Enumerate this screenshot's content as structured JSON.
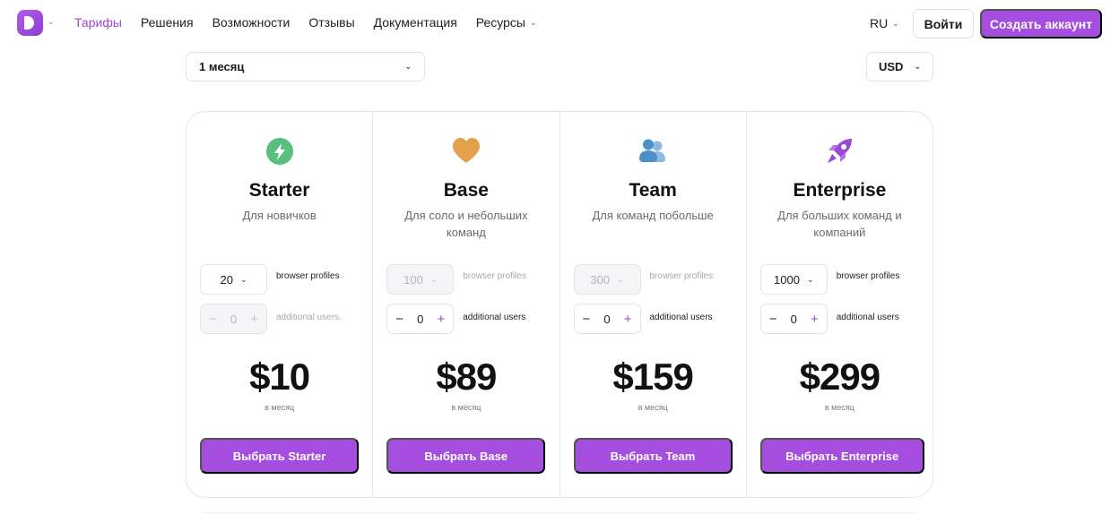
{
  "header": {
    "logo_icon": "logo-d-icon",
    "nav": [
      {
        "label": "Тарифы",
        "active": true,
        "has_dropdown": false
      },
      {
        "label": "Решения",
        "active": false,
        "has_dropdown": false
      },
      {
        "label": "Возможности",
        "active": false,
        "has_dropdown": false
      },
      {
        "label": "Отзывы",
        "active": false,
        "has_dropdown": false
      },
      {
        "label": "Документация",
        "active": false,
        "has_dropdown": false
      },
      {
        "label": "Ресурсы",
        "active": false,
        "has_dropdown": true
      }
    ],
    "language": "RU",
    "login_label": "Войти",
    "signup_label": "Создать аккаунт"
  },
  "selectors": {
    "period": "1 месяц",
    "currency": "USD"
  },
  "colors": {
    "accent": "#a44ddf",
    "starter_icon": "#57c07d",
    "base_icon": "#e3a04d",
    "team_icon": "#4a90c9",
    "enterprise_icon": "#9b47d8"
  },
  "plans": [
    {
      "icon": "lightning-icon",
      "name": "Starter",
      "description": "Для новичков",
      "profiles": "20",
      "profiles_label": "browser profiles",
      "profiles_disabled": false,
      "users": "0",
      "users_label": "additional users.",
      "users_disabled": true,
      "price": "$10",
      "per": "в месяц",
      "cta": "Выбрать Starter"
    },
    {
      "icon": "heart-icon",
      "name": "Base",
      "description": "Для соло и небольших команд",
      "profiles": "100",
      "profiles_label": "browser profiles",
      "profiles_disabled": true,
      "users": "0",
      "users_label": "additional users",
      "users_disabled": false,
      "price": "$89",
      "per": "в месяц",
      "cta": "Выбрать Base"
    },
    {
      "icon": "users-icon",
      "name": "Team",
      "description": "Для команд побольше",
      "profiles": "300",
      "profiles_label": "browser profiles",
      "profiles_disabled": true,
      "users": "0",
      "users_label": "additional users",
      "users_disabled": false,
      "price": "$159",
      "per": "в месяц",
      "cta": "Выбрать Team"
    },
    {
      "icon": "rocket-icon",
      "name": "Enterprise",
      "description": "Для больших команд и компаний",
      "profiles": "1000",
      "profiles_label": "browser profiles",
      "profiles_disabled": false,
      "users": "0",
      "users_label": "additional users",
      "users_disabled": false,
      "price": "$299",
      "per": "в месяц",
      "cta": "Выбрать Enterprise"
    }
  ]
}
